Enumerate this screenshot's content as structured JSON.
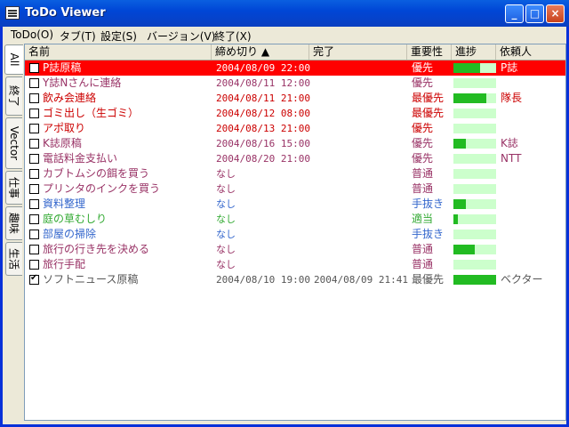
{
  "window": {
    "title": "ToDo Viewer"
  },
  "menu": [
    "ToDo(O)",
    "タブ(T)",
    "設定(S)",
    "バージョン(V)",
    "終了(X)"
  ],
  "tabs": [
    "All",
    "終了",
    "Vector",
    "仕事",
    "趣味",
    "生活"
  ],
  "columns": {
    "name": "名前",
    "deadline": "締め切り ▲",
    "done": "完了",
    "priority": "重要性",
    "progress": "進捗",
    "requester": "依頼人"
  },
  "colors": {
    "red": "#cc0000",
    "purple": "#993366",
    "blue": "#3366cc",
    "green": "#33aa33",
    "gray": "#555555",
    "selected": "#ff0000"
  },
  "rows": [
    {
      "checked": false,
      "name": "P誌原稿",
      "deadline": "2004/08/09 22:00",
      "done": "",
      "priority": "優先",
      "progress": 0.62,
      "requester": "P誌",
      "color": "#cc0000",
      "selected": true
    },
    {
      "checked": false,
      "name": "Y誌Nさんに連絡",
      "deadline": "2004/08/11 12:00",
      "done": "",
      "priority": "優先",
      "progress": 0,
      "requester": "",
      "color": "#993366"
    },
    {
      "checked": false,
      "name": "飲み会連絡",
      "deadline": "2004/08/11 21:00",
      "done": "",
      "priority": "最優先",
      "progress": 0.78,
      "requester": "隊長",
      "color": "#cc0000"
    },
    {
      "checked": false,
      "name": "ゴミ出し（生ゴミ）",
      "deadline": "2004/08/12 08:00",
      "done": "",
      "priority": "最優先",
      "progress": 0,
      "requester": "",
      "color": "#cc0000"
    },
    {
      "checked": false,
      "name": "アポ取り",
      "deadline": "2004/08/13 21:00",
      "done": "",
      "priority": "優先",
      "progress": 0,
      "requester": "",
      "color": "#cc0000"
    },
    {
      "checked": false,
      "name": "K誌原稿",
      "deadline": "2004/08/16 15:00",
      "done": "",
      "priority": "優先",
      "progress": 0.3,
      "requester": "K誌",
      "color": "#993366"
    },
    {
      "checked": false,
      "name": "電話料金支払い",
      "deadline": "2004/08/20 21:00",
      "done": "",
      "priority": "優先",
      "progress": 0,
      "requester": "NTT",
      "color": "#993366"
    },
    {
      "checked": false,
      "name": "カブトムシの餌を買う",
      "deadline": "なし",
      "done": "",
      "priority": "普通",
      "progress": 0,
      "requester": "",
      "color": "#993366"
    },
    {
      "checked": false,
      "name": "プリンタのインクを買う",
      "deadline": "なし",
      "done": "",
      "priority": "普通",
      "progress": 0,
      "requester": "",
      "color": "#993366"
    },
    {
      "checked": false,
      "name": "資料整理",
      "deadline": "なし",
      "done": "",
      "priority": "手抜き",
      "progress": 0.3,
      "requester": "",
      "color": "#3366cc"
    },
    {
      "checked": false,
      "name": "庭の草むしり",
      "deadline": "なし",
      "done": "",
      "priority": "適当",
      "progress": 0.1,
      "requester": "",
      "color": "#33aa33"
    },
    {
      "checked": false,
      "name": "部屋の掃除",
      "deadline": "なし",
      "done": "",
      "priority": "手抜き",
      "progress": 0,
      "requester": "",
      "color": "#3366cc"
    },
    {
      "checked": false,
      "name": "旅行の行き先を決める",
      "deadline": "なし",
      "done": "",
      "priority": "普通",
      "progress": 0.5,
      "requester": "",
      "color": "#993366"
    },
    {
      "checked": false,
      "name": "旅行手配",
      "deadline": "なし",
      "done": "",
      "priority": "普通",
      "progress": 0,
      "requester": "",
      "color": "#993366"
    },
    {
      "checked": true,
      "name": "ソフトニュース原稿",
      "deadline": "2004/08/10 19:00",
      "done": "2004/08/09 21:41",
      "priority": "最優先",
      "progress": 1.0,
      "requester": "ベクター",
      "color": "#555555"
    }
  ]
}
